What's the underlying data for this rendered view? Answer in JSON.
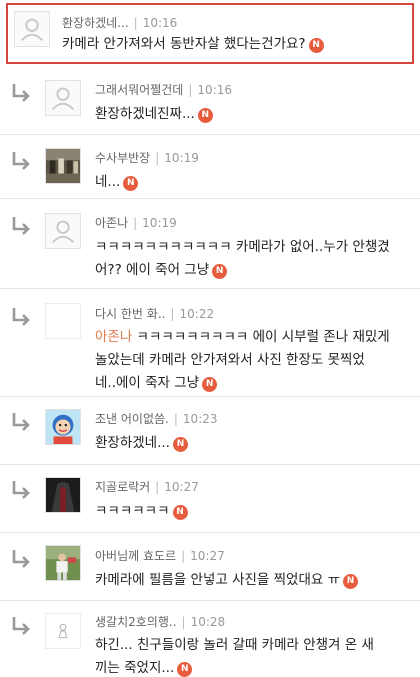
{
  "badge_label": "N",
  "comments": [
    {
      "author": "환장하겠네...",
      "time": "10:16",
      "lines": [
        "카메라 안가져와서 동반자살 했다는건가요?"
      ]
    },
    {
      "author": "그래서뭐어쩔건데",
      "time": "10:16",
      "lines": [
        "환장하겠네진짜..."
      ]
    },
    {
      "author": "수사부반장",
      "time": "10:19",
      "lines": [
        "네..."
      ]
    },
    {
      "author": "아존나",
      "time": "10:19",
      "lines": [
        "ㅋㅋㅋㅋㅋㅋㅋㅋㅋㅋㅋ 카메라가 없어..누가 안챙겼",
        "어?? 에이 죽어 그냥"
      ]
    },
    {
      "author": "다시 한번 화..",
      "time": "10:22",
      "mention": "아존나",
      "lines": [
        " ㅋㅋㅋㅋㅋㅋㅋㅋㅋ 에이 시부럴 존나 재밌게",
        "놀았는데 카메라 안가져와서 사진 한장도 못찍었",
        "네..에이 죽자 그냥"
      ]
    },
    {
      "author": "조낸 어이없씀.",
      "time": "10:23",
      "lines": [
        "환장하겠네..."
      ]
    },
    {
      "author": "지골로락커",
      "time": "10:27",
      "lines": [
        "ㅋㅋㅋㅋㅋㅋ"
      ]
    },
    {
      "author": "아버님께 효도르",
      "time": "10:27",
      "lines": [
        "카메라에 필름을 안넣고 사진을 찍었대요 ㅠ"
      ]
    },
    {
      "author": "생갈치2호의행..",
      "time": "10:28",
      "lines": [
        "하긴... 친구들이랑 놀러 갈때 카메라 안챙겨 온 새",
        "끼는 죽었지..."
      ]
    }
  ],
  "colors": {
    "badge": "#e85c3e",
    "highlight_border": "#d4453e",
    "mention": "#e07b4d"
  },
  "avatar_icons": [
    "default-avatar-icon",
    "default-avatar-icon",
    "group-photo-icon",
    "default-avatar-icon",
    "blank-avatar-icon",
    "cartoon-character-icon",
    "dark-figure-icon",
    "player-photo-icon",
    "small-figure-icon"
  ]
}
